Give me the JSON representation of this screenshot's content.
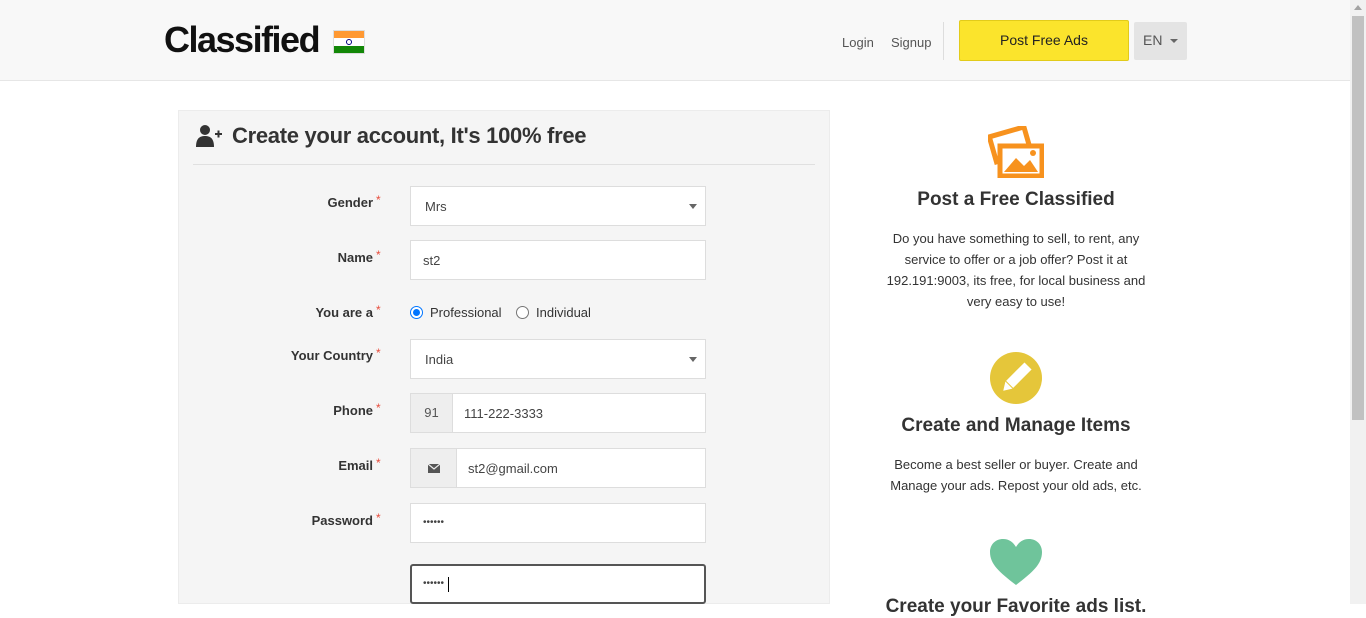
{
  "header": {
    "logo": "Classified",
    "login": "Login",
    "signup": "Signup",
    "post_ads": "Post Free Ads",
    "language": "EN"
  },
  "form": {
    "title": "Create your account, It's 100% free",
    "required_mark": "*",
    "gender": {
      "label": "Gender",
      "value": "Mrs"
    },
    "name": {
      "label": "Name",
      "value": "st2"
    },
    "you_are": {
      "label": "You are a",
      "options": [
        "Professional",
        "Individual"
      ],
      "selected": "Professional"
    },
    "country": {
      "label": "Your Country",
      "value": "India"
    },
    "phone": {
      "label": "Phone",
      "prefix": "91",
      "value": "111-222-3333"
    },
    "email": {
      "label": "Email",
      "value": "st2@gmail.com"
    },
    "password": {
      "label": "Password",
      "value": "••••••"
    },
    "password_confirm": {
      "value": "••••••"
    }
  },
  "features": [
    {
      "title": "Post a Free Classified",
      "text": "Do you have something to sell, to rent, any service to offer or a job offer? Post it at 192.191:9003, its free, for local business and very easy to use!",
      "icon": "pictures-icon",
      "color": "#f7921e"
    },
    {
      "title": "Create and Manage Items",
      "text": "Become a best seller or buyer. Create and Manage your ads. Repost your old ads, etc.",
      "icon": "pencil-icon",
      "color": "#e5c63a"
    },
    {
      "title": "Create your Favorite ads list.",
      "icon": "heart-icon",
      "color": "#6fc49b"
    }
  ],
  "colors": {
    "accent": "#fbe42c",
    "required": "#e74c3c"
  }
}
